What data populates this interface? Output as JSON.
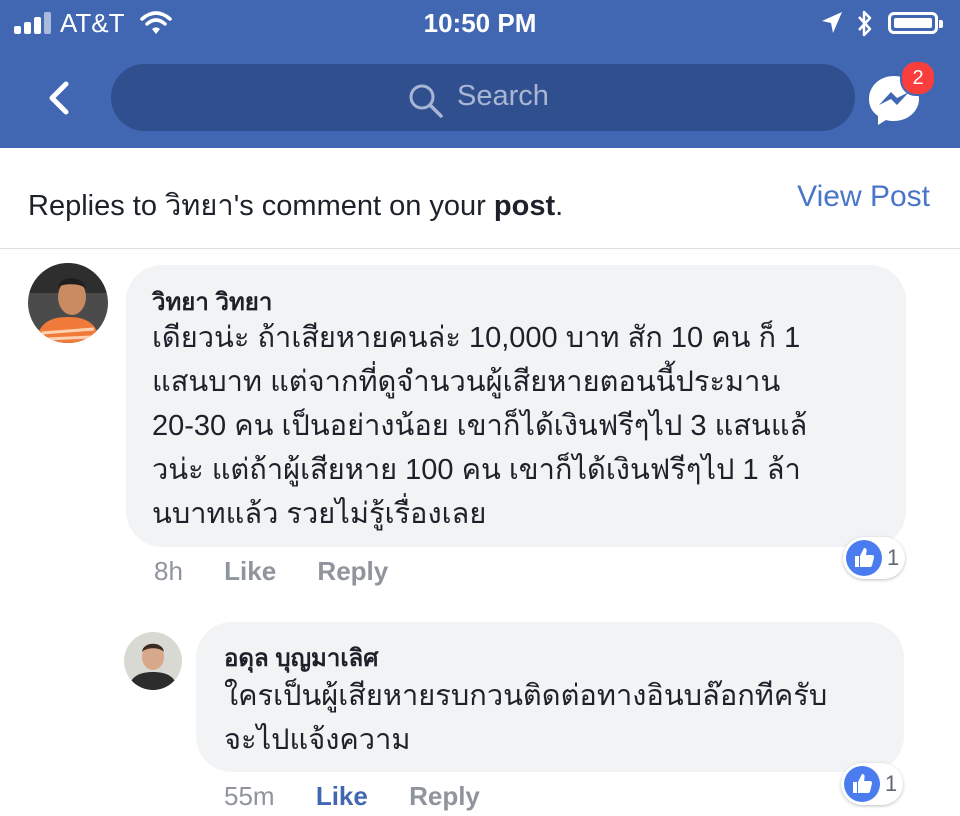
{
  "status_bar": {
    "carrier": "AT&T",
    "time": "10:50 PM"
  },
  "nav": {
    "search_placeholder": "Search",
    "messenger_badge": "2"
  },
  "header": {
    "text_prefix": "Replies to วิทยา's comment on your ",
    "text_bold": "post",
    "text_suffix": ".",
    "view_post": "View Post"
  },
  "comments": [
    {
      "name": "วิทยา วิทยา",
      "lines": [
        "เดียวน่ะ  ถ้าเสียหายคนล่ะ 10,000 บาท  สัก 10 คน ก็ 1",
        "แสนบาท  แต่จากที่ดูจำนวนผู้เสียหายตอนนี้ประมาน",
        "20-30 คน เป็นอย่างน้อย  เขาก็ได้เงินฟรีๆไป 3 แสนแล้",
        "วน่ะ  แต่ถ้าผู้เสียหาย 100 คน เขาก็ได้เงินฟรีๆไป 1 ล้า",
        "นบาทแล้ว  รวยไม่รู้เรื่องเลย"
      ],
      "time": "8h",
      "like": "Like",
      "reply": "Reply",
      "reactions": "1"
    },
    {
      "name": "อดุล บุญมาเลิศ",
      "lines": [
        "ใครเป็นผู้เสียหายรบกวนติดต่อทางอินบล๊อกทีครับ",
        "จะไปแจ้งความ"
      ],
      "time": "55m",
      "like": "Like",
      "reply": "Reply",
      "reactions": "1"
    }
  ],
  "colors": {
    "nav_blue": "#4267b2",
    "link_blue": "#4a76c9",
    "bubble": "#f2f3f5",
    "badge_red": "#fa3e3e"
  }
}
